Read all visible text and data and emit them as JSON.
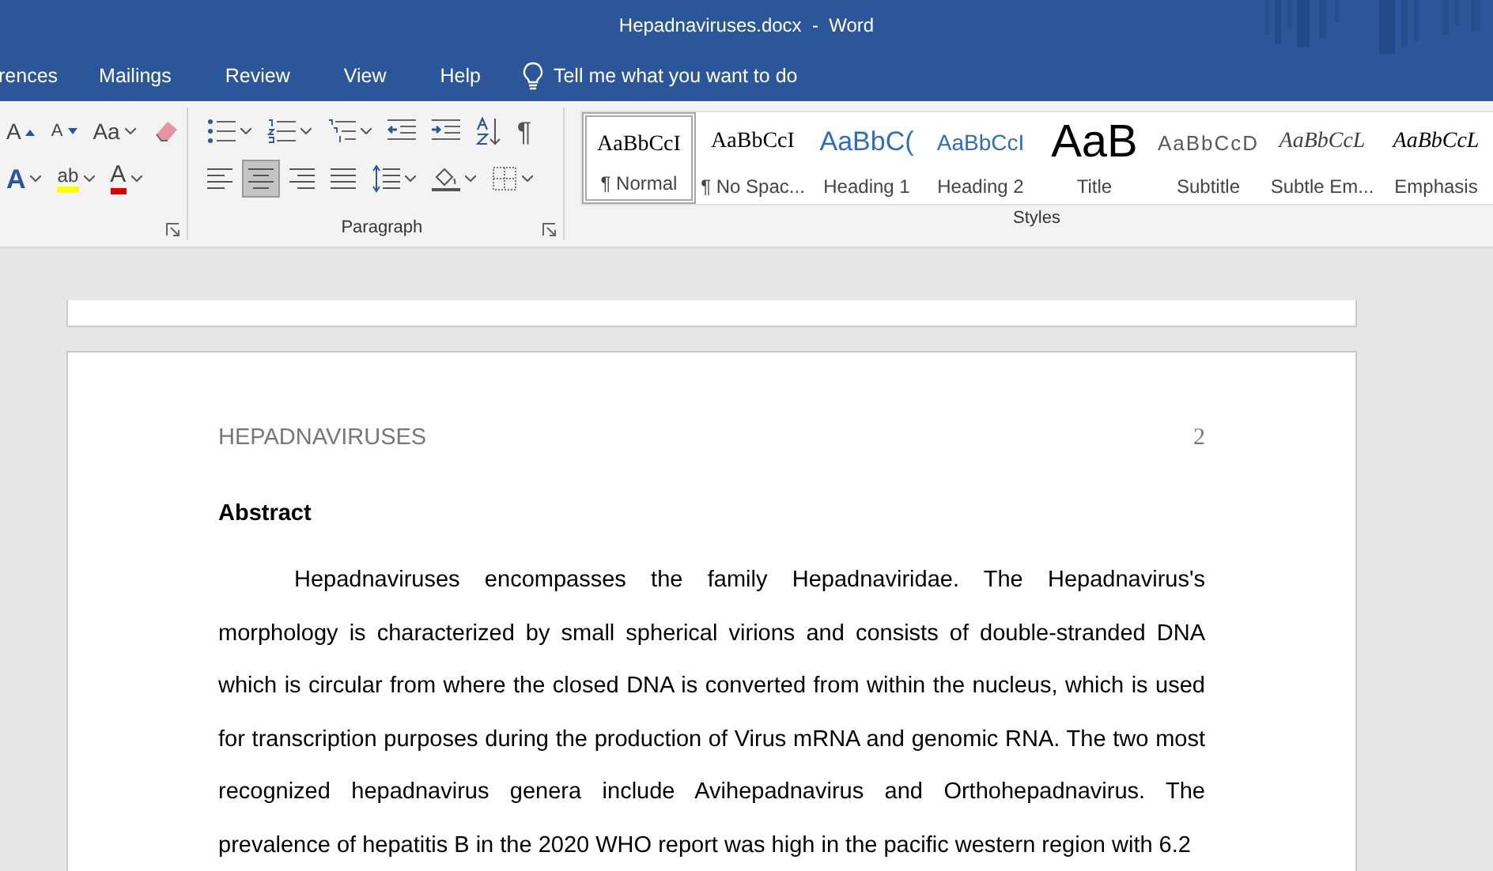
{
  "window": {
    "title": "Hepadnaviruses.docx  -  Word"
  },
  "tabs": [
    {
      "label": "rences",
      "selected": false
    },
    {
      "label": "Mailings",
      "selected": false
    },
    {
      "label": "Review",
      "selected": false
    },
    {
      "label": "View",
      "selected": false
    },
    {
      "label": "Help",
      "selected": false
    }
  ],
  "tell_me": {
    "placeholder": "Tell me what you want to do"
  },
  "font_group": {
    "rows": [
      [
        {
          "kind": "grow",
          "glyph": "A",
          "caret": false
        },
        {
          "kind": "shrink",
          "glyph": "A",
          "caret": false
        },
        {
          "kind": "case",
          "glyph": "Aa",
          "caret": true
        },
        {
          "kind": "clear",
          "caret": false
        }
      ],
      [
        {
          "kind": "effects",
          "glyph": "A",
          "caret": true
        },
        {
          "kind": "highlight",
          "glyph": "ab",
          "caret": true
        },
        {
          "kind": "fontcolor",
          "glyph": "A",
          "caret": true
        }
      ]
    ]
  },
  "paragraph_group": {
    "label": "Paragraph",
    "rows": [
      [
        {
          "kind": "bullets",
          "caret": true,
          "selected": false
        },
        {
          "kind": "numbering",
          "caret": true,
          "selected": false
        },
        {
          "kind": "multilevel",
          "caret": true,
          "selected": false
        },
        {
          "kind": "outdent",
          "caret": false,
          "selected": false
        },
        {
          "kind": "indent",
          "caret": false,
          "selected": false
        },
        {
          "kind": "sort",
          "caret": false,
          "selected": false
        },
        {
          "kind": "pilcrow",
          "glyph": "¶",
          "caret": false,
          "selected": false
        }
      ],
      [
        {
          "kind": "align_left",
          "caret": false,
          "selected": false
        },
        {
          "kind": "align_center",
          "caret": false,
          "selected": true
        },
        {
          "kind": "align_right",
          "caret": false,
          "selected": false
        },
        {
          "kind": "justify",
          "caret": false,
          "selected": false
        },
        {
          "kind": "line_spacing",
          "caret": true,
          "selected": false
        },
        {
          "kind": "shading",
          "caret": true,
          "selected": false
        },
        {
          "kind": "borders",
          "caret": true,
          "selected": false
        }
      ]
    ]
  },
  "styles_group": {
    "label": "Styles",
    "items": [
      {
        "kind": "normal",
        "sample": "AaBbCcI",
        "label": "¶ Normal",
        "selected": true
      },
      {
        "kind": "nospacing",
        "sample": "AaBbCcI",
        "label": "¶ No Spac...",
        "selected": false
      },
      {
        "kind": "heading1",
        "sample": "AaBbC(",
        "label": "Heading 1",
        "selected": false
      },
      {
        "kind": "heading2",
        "sample": "AaBbCcI",
        "label": "Heading 2",
        "selected": false
      },
      {
        "kind": "title",
        "sample": "AaB",
        "label": "Title",
        "selected": false
      },
      {
        "kind": "subtitle",
        "sample": "AaBbCcD",
        "label": "Subtitle",
        "selected": false
      },
      {
        "kind": "subtle",
        "sample": "AaBbCcL",
        "label": "Subtle Em...",
        "selected": false
      },
      {
        "kind": "emphasis",
        "sample": "AaBbCcL",
        "label": "Emphasis",
        "selected": false
      }
    ]
  },
  "document": {
    "header": "HEPADNAVIRUSES",
    "page_number": "2",
    "heading": "Abstract",
    "paragraph": "Hepadnaviruses encompasses the family Hepadnaviridae. The Hepadnavirus's morphology is characterized by small spherical virions and consists of double-stranded DNA which is circular from where the closed DNA is converted from within the nucleus, which is used for transcription purposes during the production of Virus mRNA and genomic RNA. The two most recognized hepadnavirus genera include Avihepadnavirus and Orthohepadnavirus. The prevalence of hepatitis B in the 2020 WHO report was high in the pacific western region with 6.2"
  }
}
